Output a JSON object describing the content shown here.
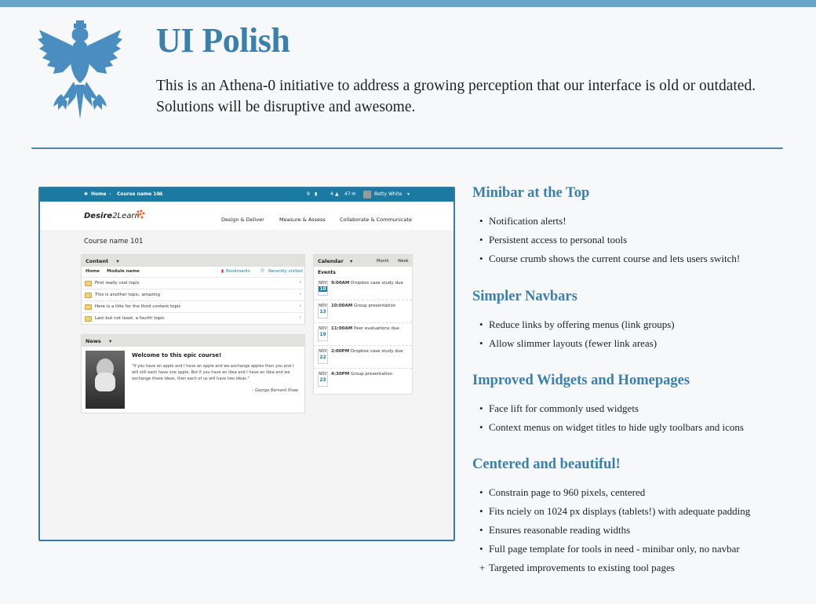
{
  "header": {
    "title": "UI Polish",
    "intro": "This is an Athena-0 initiative to address a growing perception that our interface is old or outdated. Solutions will be disruptive and awesome."
  },
  "colors": {
    "accent": "#3b7fac",
    "topbar": "#68a4c8",
    "minibar": "#1a7aa1"
  },
  "mockup": {
    "minibar": {
      "home": "Home",
      "crumb": "Course name 101",
      "alerts1": "9",
      "alerts2": "4",
      "alerts3": "47",
      "user": "Betty White"
    },
    "logo": {
      "desire": "Desire",
      "two_learn": "2Learn"
    },
    "nav": [
      "Design & Deliver",
      "Measure & Assess",
      "Collaborate & Communicate"
    ],
    "course_name": "Course name 101",
    "content_widget": {
      "title": "Content",
      "col_home": "Home",
      "col_module": "Module name",
      "bookmarks": "Bookmarks",
      "recent": "Recently visited",
      "items": [
        "First really cool topic",
        "This is another topic, amazing",
        "Here is a title for the third content topic",
        "Last but not least, a fourth topic"
      ]
    },
    "news_widget": {
      "title": "News",
      "headline": "Welcome to this epic course!",
      "quote": "\"If you have an apple and I have an apple and we exchange apples then you and I will still each have one apple. But if you have an idea and I have an idea and we exchange these ideas, then each of us will have two ideas.\"",
      "attribution": "– George Bernard Shaw"
    },
    "calendar_widget": {
      "title": "Calendar",
      "month": "Month",
      "week": "Week",
      "events_label": "Events",
      "events": [
        {
          "mon": "NOV",
          "day": "10",
          "time": "9:00AM",
          "name": "Dropbox case study due"
        },
        {
          "mon": "NOV",
          "day": "13",
          "time": "10:00AM",
          "name": "Group presentation"
        },
        {
          "mon": "NOV",
          "day": "19",
          "time": "11:00AM",
          "name": "Peer evaluations due"
        },
        {
          "mon": "NOV",
          "day": "22",
          "time": "2:00PM",
          "name": "Dropbox case study due"
        },
        {
          "mon": "NOV",
          "day": "23",
          "time": "4:30PM",
          "name": "Group presentation"
        }
      ]
    }
  },
  "sections": [
    {
      "title": "Minibar at the Top",
      "items": [
        {
          "bullet": "•",
          "text": "Notification alerts!"
        },
        {
          "bullet": "•",
          "text": "Persistent access to personal tools"
        },
        {
          "bullet": "•",
          "text": "Course crumb shows the current course and lets users switch!"
        }
      ]
    },
    {
      "title": "Simpler Navbars",
      "items": [
        {
          "bullet": "•",
          "text": "Reduce links by offering menus (link groups)"
        },
        {
          "bullet": "•",
          "text": "Allow slimmer layouts (fewer link areas)"
        }
      ]
    },
    {
      "title": "Improved Widgets and Homepages",
      "items": [
        {
          "bullet": "•",
          "text": "Face lift for commonly used widgets"
        },
        {
          "bullet": "•",
          "text": "Context menus on widget titles to hide ugly toolbars and icons"
        }
      ]
    },
    {
      "title": "Centered and beautiful!",
      "items": [
        {
          "bullet": "•",
          "text": "Constrain page to 960 pixels, centered"
        },
        {
          "bullet": "•",
          "text": "Fits nciely on 1024 px displays (tablets!) with adequate padding"
        },
        {
          "bullet": "•",
          "text": "Ensures reasonable reading widths"
        },
        {
          "bullet": "•",
          "text": "Full page template for tools in need - minibar only, no navbar"
        },
        {
          "bullet": "+",
          "text": "Targeted improvements to existing tool pages"
        }
      ]
    }
  ]
}
